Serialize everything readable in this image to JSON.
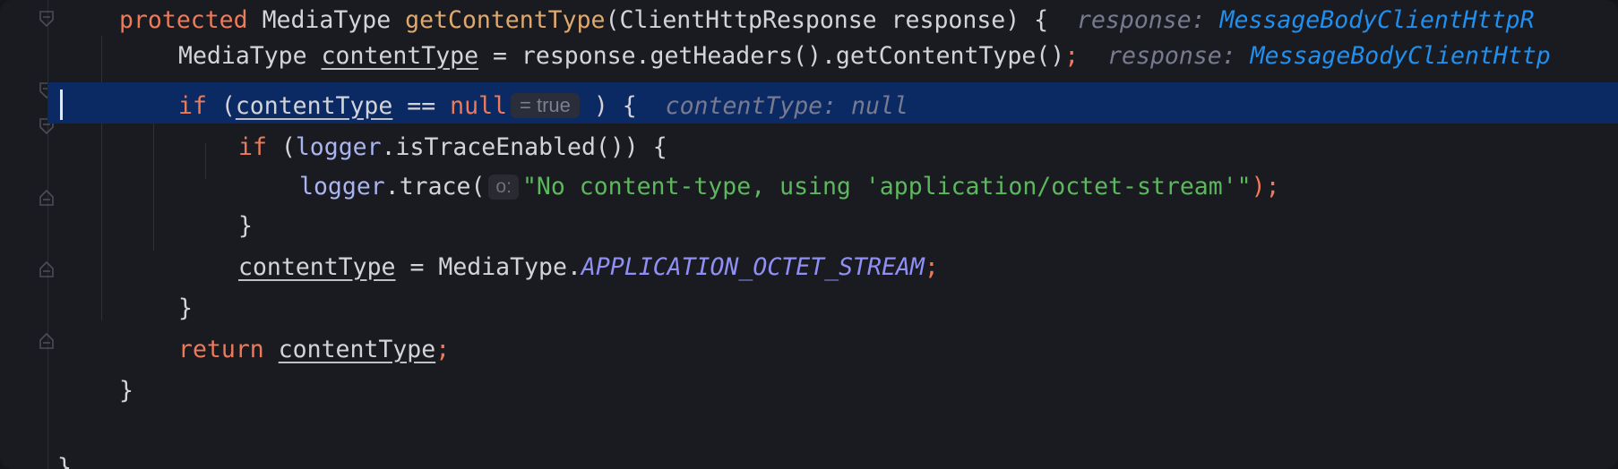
{
  "editor": {
    "lines": [
      {
        "kw": "protected",
        "type": "MediaType",
        "method": "getContentType",
        "rest": "(ClientHttpResponse response) {",
        "hint_name": "response:",
        "hint_type": "MessageBodyClientHttpR"
      },
      {
        "type": "MediaType",
        "var": "contentType",
        "rest": " = response.getHeaders().getContentType()",
        "semi": ";",
        "hint_name": "response:",
        "hint_type": "MessageBodyClientHttp"
      },
      {
        "kw": "if",
        "open": " (",
        "var": "contentType",
        "op": " == ",
        "null": "null",
        "inline_value": "= true",
        "close": " ) {",
        "hint": "contentType: null"
      },
      {
        "kw": "if",
        "open": " (",
        "field": "logger",
        "rest": ".isTraceEnabled()) {"
      },
      {
        "field": "logger",
        "call": ".trace(",
        "param_hint": "o:",
        "string": "\"No content-type, using 'application/octet-stream'\"",
        "end": ");"
      },
      {
        "brace": "}"
      },
      {
        "var": "contentType",
        "rest": " = MediaType.",
        "constant": "APPLICATION_OCTET_STREAM",
        "semi": ";"
      },
      {
        "brace": "}"
      },
      {
        "kw": "return",
        "var": "contentType",
        "semi": ";"
      },
      {
        "brace": "}"
      },
      {
        "brace": "}"
      }
    ]
  }
}
